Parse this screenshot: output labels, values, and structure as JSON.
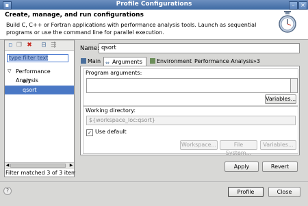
{
  "window": {
    "title": "Profile Configurations",
    "minimize_glyph": "–",
    "close_glyph": "×"
  },
  "header": {
    "title": "Create, manage, and run configurations",
    "description": "Build C, C++ or Fortran applications with performance analysis tools.  Launch as sequential programs or use the command line for parallel execution.",
    "icon": "stopwatch-icon"
  },
  "left": {
    "toolbar_icons": [
      "new-config-icon",
      "duplicate-icon",
      "delete-icon",
      "collapse-all-icon",
      "filter-icon"
    ],
    "filter_value": "type filter text",
    "tree": {
      "group": "Performance Analysis",
      "items": [
        "art",
        "qsort"
      ],
      "selected": "qsort"
    },
    "status": "Filter matched 3 of 3 item"
  },
  "main": {
    "name_label": "Name:",
    "name_value": "qsort",
    "tabs": [
      {
        "label": "Main",
        "icon": "main-tab-icon"
      },
      {
        "label": "Arguments",
        "icon": "arguments-tab-icon",
        "active": true
      },
      {
        "label": "Environment",
        "icon": "environment-tab-icon"
      },
      {
        "label": "Performance Analysis",
        "icon": ""
      },
      {
        "label": "»3",
        "icon": ""
      }
    ],
    "program_args_label": "Program arguments:",
    "program_args_value": "",
    "variables_label": "Variables...",
    "working_dir_label": "Working directory:",
    "working_dir_value": "${workspace_loc:qsort}",
    "use_default_label": "Use default",
    "use_default_checked": true,
    "workspace_btn": "Workspace...",
    "filesystem_btn": "File System...",
    "variables2_btn": "Variables..."
  },
  "buttons": {
    "apply": "Apply",
    "revert": "Revert",
    "profile": "Profile",
    "close": "Close",
    "help": "?"
  },
  "colors": {
    "selection": "#4a78c5",
    "titlebar": "#3e6aa3",
    "delete_red": "#c62a20"
  }
}
